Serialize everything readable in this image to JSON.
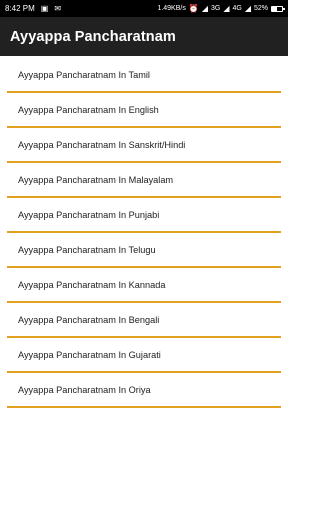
{
  "status_bar": {
    "time": "8:42 PM",
    "notifications": [
      "image-icon",
      "mail-icon"
    ],
    "network_speed": "1.49KB/s",
    "network_type_1": "3G",
    "network_type_2": "4G",
    "battery_percent": "52%",
    "battery_level": 0.52
  },
  "app_bar": {
    "title": "Ayyappa Pancharatnam"
  },
  "list": {
    "accent_color": "#e0a020",
    "items": [
      {
        "label": "Ayyappa Pancharatnam In Tamil"
      },
      {
        "label": "Ayyappa Pancharatnam In English"
      },
      {
        "label": "Ayyappa Pancharatnam In Sanskrit/Hindi"
      },
      {
        "label": "Ayyappa Pancharatnam In Malayalam"
      },
      {
        "label": "Ayyappa Pancharatnam In Punjabi"
      },
      {
        "label": "Ayyappa Pancharatnam In Telugu"
      },
      {
        "label": "Ayyappa Pancharatnam In Kannada"
      },
      {
        "label": "Ayyappa Pancharatnam In Bengali"
      },
      {
        "label": "Ayyappa Pancharatnam In Gujarati"
      },
      {
        "label": "Ayyappa Pancharatnam In Oriya"
      }
    ]
  }
}
